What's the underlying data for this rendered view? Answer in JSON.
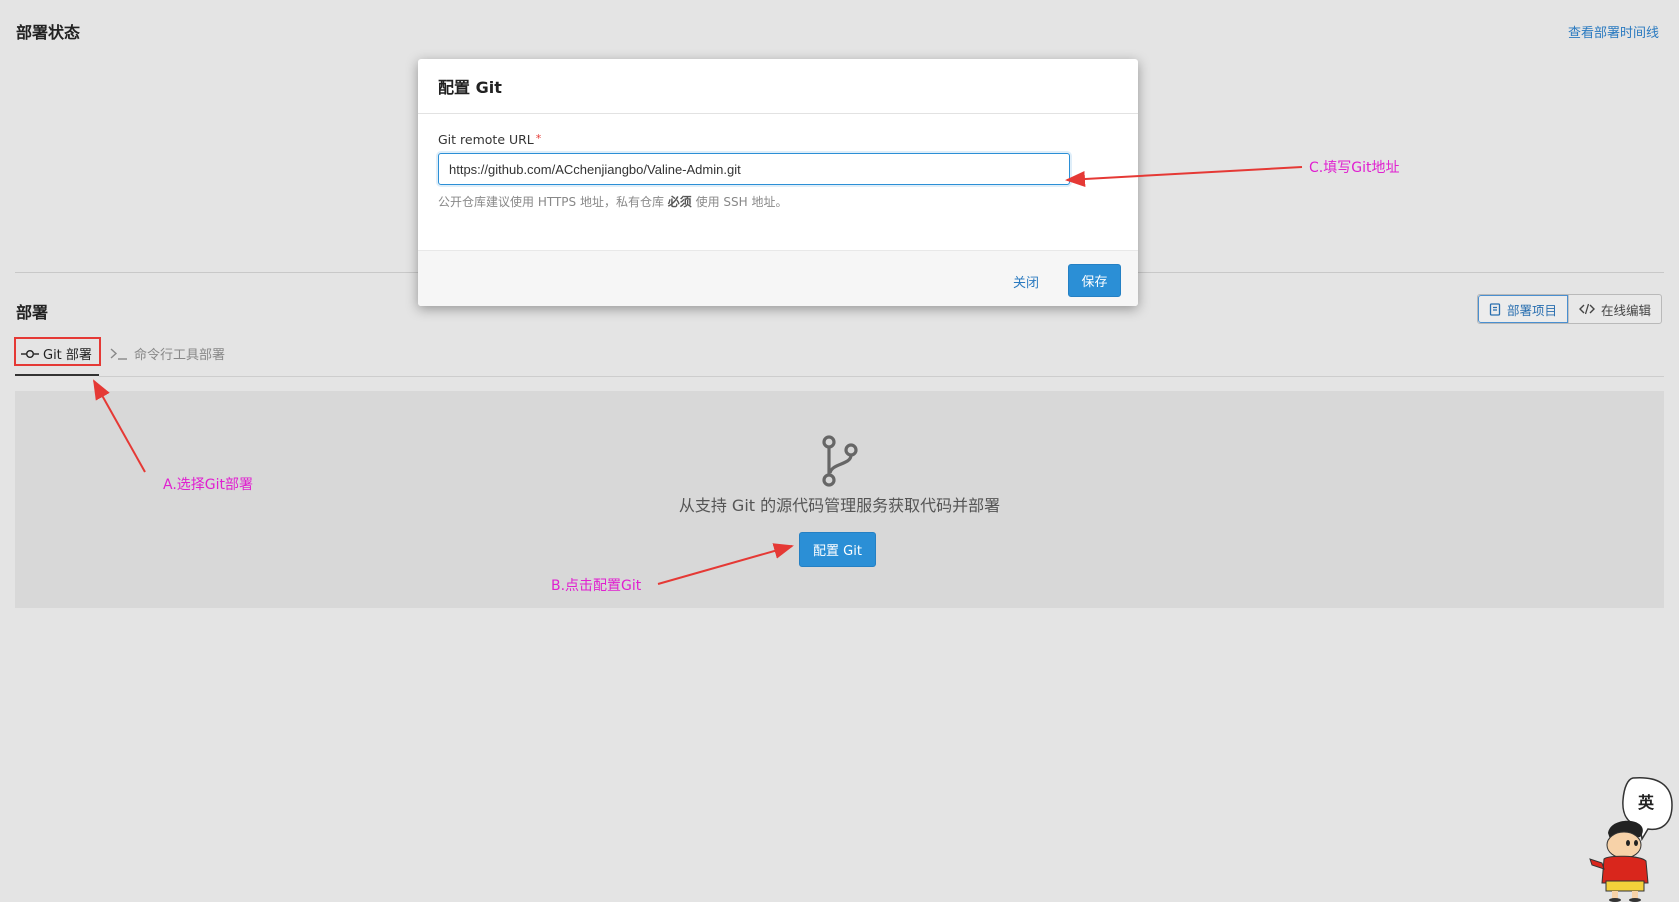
{
  "deploy_status": {
    "title": "部署状态",
    "timeline_link": "查看部署时间线"
  },
  "deploy": {
    "title": "部署",
    "view_toggle": {
      "items": [
        {
          "label": "部署项目",
          "icon": "document-icon",
          "active": true
        },
        {
          "label": "在线编辑",
          "icon": "code-icon",
          "active": false
        }
      ]
    },
    "tabs": [
      {
        "label": "Git 部署",
        "icon": "git-commit-icon",
        "active": true
      },
      {
        "label": "命令行工具部署",
        "icon": "terminal-icon",
        "active": false
      }
    ],
    "empty_state": {
      "icon": "git-branch-icon",
      "text": "从支持 Git 的源代码管理服务获取代码并部署",
      "button_label": "配置 Git"
    }
  },
  "modal": {
    "title": "配置 Git",
    "field_label": "Git remote URL",
    "required_mark": "*",
    "url_value": "https://github.com/ACchenjiangbo/Valine-Admin.git",
    "help_text_pre": "公开仓库建议使用 HTTPS 地址，私有仓库 ",
    "help_text_bold": "必须",
    "help_text_post": " 使用 SSH 地址。",
    "close_label": "关闭",
    "save_label": "保存"
  },
  "annotations": {
    "a": "A.选择Git部署",
    "b": "B.点击配置Git",
    "c": "C.填写Git地址",
    "color": "#e020d0",
    "arrow_color": "#e53935"
  },
  "mascot": {
    "bubble_text": "英"
  },
  "colors": {
    "primary": "#2b8fd6",
    "link": "#2a7ac0",
    "background": "#e4e4e4"
  }
}
